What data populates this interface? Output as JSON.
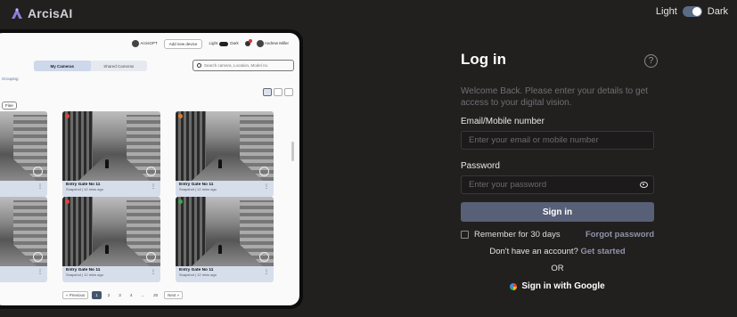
{
  "brand": {
    "name": "ArcisAI"
  },
  "theme_toggle": {
    "light_label": "Light",
    "dark_label": "Dark"
  },
  "preview": {
    "header": {
      "gpt_label": "ArcisGPT",
      "add_device": "Add new device",
      "light": "Light",
      "dark": "Dark",
      "user": "Andrew Miller"
    },
    "tabs": [
      {
        "label": "My Cameras"
      },
      {
        "label": "Shared Cameras"
      }
    ],
    "search_placeholder": "Search camera, Location, Model no.",
    "grouping_label": "Grouping",
    "chip_label": "Fine",
    "cameras": [
      {
        "name": "Entry Gate No 11",
        "meta": "Snapshot | 12 mins ago",
        "status_color": "#e0443a"
      },
      {
        "name": "Entry Gate No 11",
        "meta": "Snapshot | 12 mins ago",
        "status_color": "#e07a2a"
      },
      {
        "name": "Entry Gate No 11",
        "meta": "Snapshot | 12 mins ago",
        "status_color": "#e0443a"
      },
      {
        "name": "Entry Gate No 11",
        "meta": "Snapshot | 12 mins ago",
        "status_color": "#3aa84a"
      }
    ],
    "pager": {
      "prev": "« Previous",
      "pages": [
        "1",
        "2",
        "3",
        "4",
        "...",
        "20"
      ],
      "next": "Next »"
    }
  },
  "login": {
    "title": "Log in",
    "help": "?",
    "welcome": "Welcome Back. Please enter your details to get access to your digital vision.",
    "email_label": "Email/Mobile number",
    "email_placeholder": "Enter your email or mobile number",
    "password_label": "Password",
    "password_placeholder": "Enter your password",
    "signin": "Sign in",
    "remember": "Remember for 30 days",
    "forgot": "Forgot password",
    "no_account": "Don't have an account?",
    "get_started": "Get started",
    "or": "OR",
    "google": "Sign in with Google"
  },
  "colors": {
    "background": "#221f1f",
    "primary_button": "#576077",
    "link": "#8e95a8"
  }
}
